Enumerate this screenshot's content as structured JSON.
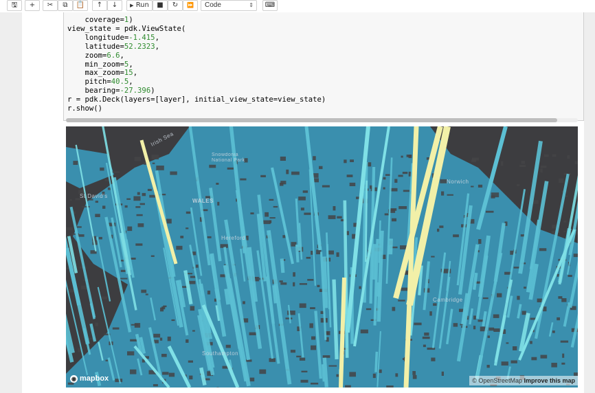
{
  "toolbar": {
    "buttons": [
      {
        "icon": "save-icon",
        "glyph": "🖫"
      },
      {
        "icon": "plus-icon",
        "glyph": "+"
      },
      {
        "icon": "cut-icon",
        "glyph": "✂"
      },
      {
        "icon": "copy-icon",
        "glyph": "⧉"
      },
      {
        "icon": "paste-icon",
        "glyph": "📋"
      },
      {
        "icon": "arrow-up-icon",
        "glyph": "↑"
      },
      {
        "icon": "arrow-down-icon",
        "glyph": "↓"
      },
      {
        "icon": "stop-icon",
        "glyph": "■"
      },
      {
        "icon": "restart-icon",
        "glyph": "↻"
      },
      {
        "icon": "fast-forward-icon",
        "glyph": "⏩"
      },
      {
        "icon": "keyboard-icon",
        "glyph": "⌨"
      }
    ],
    "run_label": "Run",
    "run_glyph": "▶",
    "cell_type": "Code"
  },
  "code": {
    "lines": [
      "    coverage=1)",
      "view_state = pdk.ViewState(",
      "    longitude=-1.415,",
      "    latitude=52.2323,",
      "    zoom=6.6,",
      "    min_zoom=5,",
      "    max_zoom=15,",
      "    pitch=40.5,",
      "    bearing=-27.396)",
      "r = pdk.Deck(layers=[layer], initial_view_state=view_state)",
      "r.show()"
    ]
  },
  "map": {
    "labels": [
      "Irish Sea",
      "Snowdonia National Park",
      "WALES",
      "St David's",
      "Hereford",
      "Southampton",
      "Cambridge",
      "Norwich"
    ],
    "logo": "mapbox",
    "attribution_prefix": "© OpenStreetMap",
    "attribution_link": "Improve this map",
    "colors": {
      "land": "#3c93b2",
      "water": "#3d3d40",
      "bar_blue": "#5cc0d4",
      "bar_cyan": "#7fe0e6",
      "bar_yellow": "#f2f0a8"
    }
  }
}
